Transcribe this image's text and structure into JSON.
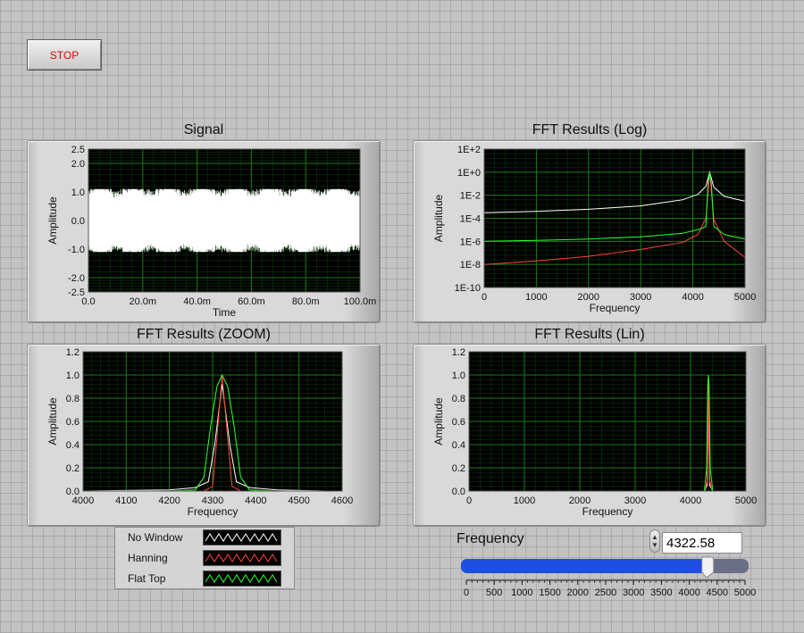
{
  "stop_label": "STOP",
  "colors": {
    "plot_bg": "#000000",
    "grid": "#1a7a1a",
    "no_window": "#ffffff",
    "hanning": "#ff4040",
    "flat_top": "#30ff30",
    "slider_fill": "#1f4fe0"
  },
  "graphs": {
    "signal": {
      "title": "Signal",
      "xlabel": "Time",
      "ylabel": "Amplitude"
    },
    "fft_log": {
      "title": "FFT Results (Log)",
      "xlabel": "Frequency",
      "ylabel": "Amplitude"
    },
    "fft_zoom": {
      "title": "FFT Results (ZOOM)",
      "xlabel": "Frequency",
      "ylabel": "Amplitude"
    },
    "fft_lin": {
      "title": "FFT Results (Lin)",
      "xlabel": "Frequency",
      "ylabel": "Amplitude"
    }
  },
  "legend": [
    {
      "label": "No Window",
      "color": "#ffffff"
    },
    {
      "label": "Hanning",
      "color": "#ff4040"
    },
    {
      "label": "Flat Top",
      "color": "#30ff30"
    }
  ],
  "frequency_control": {
    "label": "Frequency",
    "value": "4322.58",
    "min": 0,
    "max": 5000,
    "ticks": [
      "0",
      "500",
      "1000",
      "1500",
      "2000",
      "2500",
      "3000",
      "3500",
      "4000",
      "4500",
      "5000"
    ]
  },
  "chart_data": [
    {
      "type": "line",
      "name": "signal",
      "title": "Signal",
      "xlabel": "Time",
      "ylabel": "Amplitude",
      "xlim": [
        0,
        0.1
      ],
      "ylim": [
        -2.5,
        2.5
      ],
      "grid": true,
      "x_ticks": [
        "0.0",
        "20.0m",
        "40.0m",
        "60.0m",
        "80.0m",
        "100.0m"
      ],
      "y_ticks": [
        "2.5",
        "2.0",
        "1.0",
        "0.0",
        "-1.0",
        "-2.0",
        "-2.5"
      ],
      "y_tick_values": [
        2.5,
        2.0,
        1.0,
        0.0,
        -1.0,
        -2.0,
        -2.5
      ],
      "series": [
        {
          "color": "#ffffff",
          "frequency": 4322.58,
          "amplitude_range": [
            -1.1,
            1.1
          ]
        }
      ]
    },
    {
      "type": "line",
      "name": "fft_log",
      "title": "FFT Results (Log)",
      "xlabel": "Frequency",
      "ylabel": "Amplitude",
      "scale_y": "log",
      "xlim": [
        0,
        5000
      ],
      "ylim": [
        1e-10,
        100
      ],
      "grid": true,
      "x_ticks": [
        "0",
        "1000",
        "2000",
        "3000",
        "4000",
        "5000"
      ],
      "y_ticks": [
        "1E+2",
        "1E+0",
        "1E-2",
        "1E-4",
        "1E-6",
        "1E-8",
        "1E-10"
      ],
      "y_tick_values": [
        100,
        1,
        0.01,
        0.0001,
        1e-06,
        1e-08,
        1e-10
      ],
      "series": [
        {
          "color": "#ffffff",
          "x": [
            0,
            1000,
            2000,
            3000,
            3800,
            4100,
            4250,
            4322,
            4400,
            4600,
            5000
          ],
          "y": [
            0.0003,
            0.0004,
            0.0006,
            0.0012,
            0.004,
            0.012,
            0.06,
            1.0,
            0.05,
            0.008,
            0.003
          ]
        },
        {
          "color": "#ff4040",
          "x": [
            0,
            1000,
            2000,
            3000,
            3800,
            4100,
            4250,
            4322,
            4400,
            4600,
            5000
          ],
          "y": [
            1e-08,
            2e-08,
            5e-08,
            2e-07,
            8e-07,
            4e-06,
            0.0001,
            1.0,
            8e-05,
            1e-06,
            4e-08
          ]
        },
        {
          "color": "#30ff30",
          "x": [
            0,
            1000,
            2000,
            3000,
            3800,
            4150,
            4250,
            4290,
            4322,
            4355,
            4400,
            4600,
            5000
          ],
          "y": [
            1e-06,
            1.2e-06,
            1.6e-06,
            2.5e-06,
            5e-06,
            1.2e-05,
            2e-05,
            0.1,
            1.0,
            0.1,
            2e-05,
            4e-06,
            1.6e-06
          ]
        }
      ]
    },
    {
      "type": "line",
      "name": "fft_zoom",
      "title": "FFT Results (ZOOM)",
      "xlabel": "Frequency",
      "ylabel": "Amplitude",
      "xlim": [
        4000,
        4600
      ],
      "ylim": [
        0,
        1.2
      ],
      "grid": true,
      "x_ticks": [
        "4000",
        "4100",
        "4200",
        "4300",
        "4400",
        "4500",
        "4600"
      ],
      "y_ticks": [
        "1.2",
        "1.0",
        "0.8",
        "0.6",
        "0.4",
        "0.2",
        "0.0"
      ],
      "y_tick_values": [
        1.2,
        1.0,
        0.8,
        0.6,
        0.4,
        0.2,
        0.0
      ],
      "series": [
        {
          "color": "#ffffff",
          "x": [
            4000,
            4200,
            4260,
            4290,
            4305,
            4322,
            4340,
            4355,
            4385,
            4450,
            4560
          ],
          "y": [
            0.0,
            0.01,
            0.03,
            0.08,
            0.4,
            0.92,
            0.4,
            0.08,
            0.03,
            0.01,
            0.0
          ]
        },
        {
          "color": "#ff4040",
          "x": [
            4000,
            4200,
            4280,
            4300,
            4310,
            4322,
            4335,
            4345,
            4365,
            4450,
            4560
          ],
          "y": [
            0.0,
            0.0,
            0.0,
            0.04,
            0.45,
            1.0,
            0.45,
            0.04,
            0.0,
            0.0,
            0.0
          ]
        },
        {
          "color": "#30ff30",
          "x": [
            4000,
            4200,
            4260,
            4280,
            4295,
            4310,
            4322,
            4335,
            4350,
            4365,
            4385,
            4450,
            4560
          ],
          "y": [
            0.0,
            0.0,
            0.01,
            0.12,
            0.55,
            0.9,
            1.0,
            0.9,
            0.55,
            0.12,
            0.01,
            0.0,
            0.0
          ]
        }
      ]
    },
    {
      "type": "line",
      "name": "fft_lin",
      "title": "FFT Results (Lin)",
      "xlabel": "Frequency",
      "ylabel": "Amplitude",
      "xlim": [
        0,
        5000
      ],
      "ylim": [
        0,
        1.2
      ],
      "grid": true,
      "x_ticks": [
        "0",
        "1000",
        "2000",
        "3000",
        "4000",
        "5000"
      ],
      "y_ticks": [
        "1.2",
        "1.0",
        "0.8",
        "0.6",
        "0.4",
        "0.2",
        "0.0"
      ],
      "y_tick_values": [
        1.2,
        1.0,
        0.8,
        0.6,
        0.4,
        0.2,
        0.0
      ],
      "series": [
        {
          "color": "#ffffff",
          "x": [
            0,
            4250,
            4300,
            4322,
            4345,
            4400,
            5000
          ],
          "y": [
            0.0,
            0.0,
            0.05,
            0.92,
            0.05,
            0.0,
            0.0
          ]
        },
        {
          "color": "#ff4040",
          "x": [
            0,
            4260,
            4305,
            4322,
            4340,
            4390,
            5000
          ],
          "y": [
            0.0,
            0.0,
            0.1,
            1.0,
            0.1,
            0.0,
            0.0
          ]
        },
        {
          "color": "#30ff30",
          "x": [
            0,
            4250,
            4290,
            4310,
            4322,
            4335,
            4355,
            4400,
            5000
          ],
          "y": [
            0.0,
            0.0,
            0.2,
            0.9,
            1.0,
            0.9,
            0.2,
            0.0,
            0.0
          ]
        }
      ]
    }
  ]
}
